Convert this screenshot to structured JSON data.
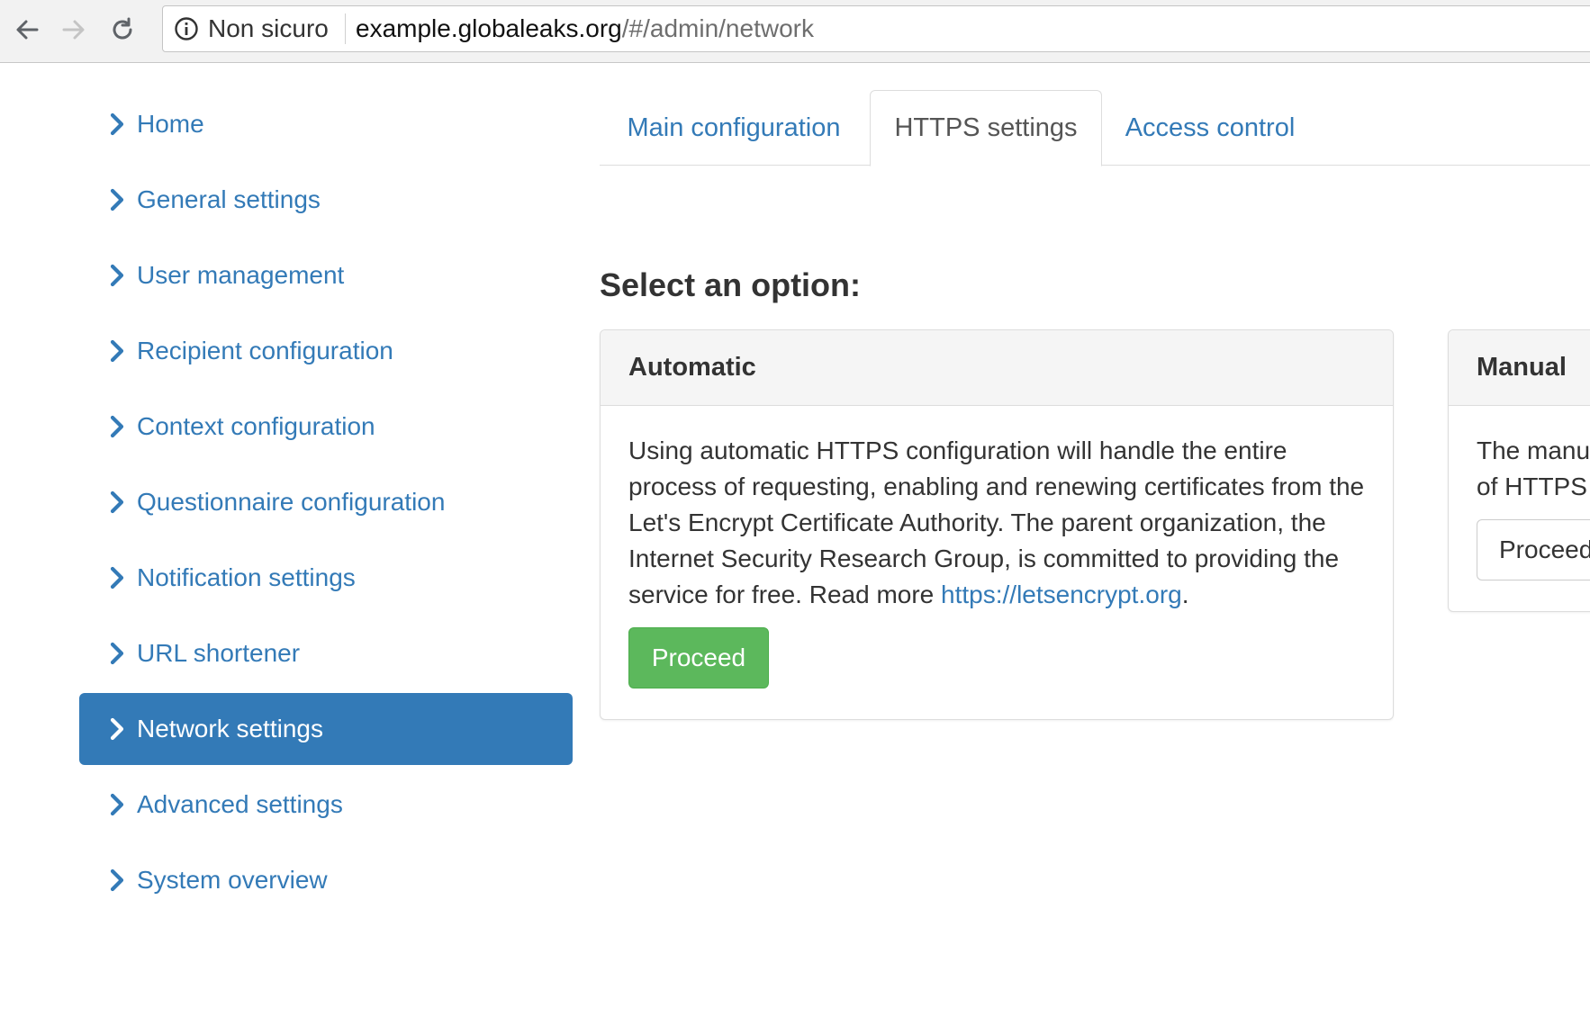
{
  "browser": {
    "security_label": "Non sicuro",
    "url_host": "example.globaleaks.org",
    "url_path": "/#/admin/network"
  },
  "sidebar": {
    "items": [
      {
        "label": "Home"
      },
      {
        "label": "General settings"
      },
      {
        "label": "User management"
      },
      {
        "label": "Recipient configuration"
      },
      {
        "label": "Context configuration"
      },
      {
        "label": "Questionnaire configuration"
      },
      {
        "label": "Notification settings"
      },
      {
        "label": "URL shortener"
      },
      {
        "label": "Network settings",
        "active": true
      },
      {
        "label": "Advanced settings"
      },
      {
        "label": "System overview"
      }
    ]
  },
  "tabs": [
    {
      "label": "Main configuration"
    },
    {
      "label": "HTTPS settings",
      "active": true
    },
    {
      "label": "Access control"
    }
  ],
  "main": {
    "heading": "Select an option:",
    "automatic": {
      "title": "Automatic",
      "text": "Using automatic HTTPS configuration will handle the entire process of requesting, enabling and renewing certificates from the Let's Encrypt Certificate Authority. The parent organization, the Internet Security Research Group, is committed to providing the service for free. Read more ",
      "link_text": "https://letsencrypt.org",
      "text_end": ".",
      "button": "Proceed"
    },
    "manual": {
      "title": "Manual",
      "text_line1": "The manu",
      "text_line2": "of HTTPS",
      "button": "Proceed"
    }
  },
  "colors": {
    "primary": "#337ab7",
    "success": "#5cb85c",
    "panel_header": "#f5f5f5",
    "border": "#dddddd"
  },
  "icons": {
    "back": "arrow-left-icon",
    "forward": "arrow-right-icon",
    "reload": "reload-icon",
    "info": "info-circle-icon",
    "chevron": "chevron-right-icon"
  }
}
